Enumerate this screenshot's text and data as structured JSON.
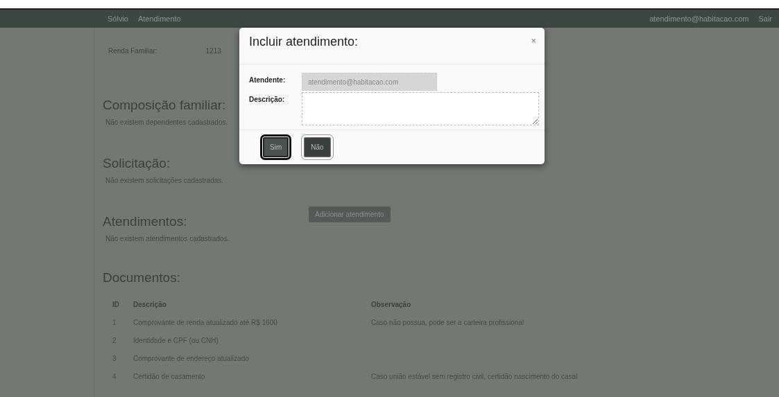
{
  "navbar": {
    "brand": "Sólvio",
    "link": "Atendimento",
    "user": "atendimento@habitacao.com",
    "logout": "Sair"
  },
  "income": {
    "label": "Renda Familiar:",
    "value": "1213"
  },
  "sections": [
    {
      "title": "Composição familiar:",
      "empty_text": "Não existem dependentes cadastrados."
    },
    {
      "title": "Solicitação:",
      "empty_text": "Não existem solicitações cadastradas."
    },
    {
      "title": "Atendimentos:",
      "empty_text": "Não existem atendimentos cadastrados.",
      "button": "Adicionar atendimento"
    }
  ],
  "documents": {
    "title": "Documentos:",
    "columns": [
      "ID",
      "Descrição",
      "Observação"
    ],
    "rows": [
      [
        "1",
        "Comprovante de renda atualizado até R$ 1600",
        "Caso não possua, pode ser a carteira profissional"
      ],
      [
        "2",
        "Identidade e CPF (ou CNH)",
        ""
      ],
      [
        "3",
        "Comprovante de endereço atualizado",
        ""
      ],
      [
        "4",
        "Certidão de casamento",
        "Caso união estável sem registro civil, certidão nascimento do casal"
      ]
    ]
  },
  "modal": {
    "title": "Incluir atendimento:",
    "close": "×",
    "fields": [
      {
        "label": "Atendente:",
        "kind": "input",
        "value": "atendimento@habitacao.com",
        "disabled": true
      },
      {
        "label": "Descrição:",
        "kind": "textarea"
      }
    ],
    "buttons": [
      {
        "label": "Sim",
        "focused": true
      },
      {
        "label": "Não",
        "focused": false
      }
    ]
  }
}
